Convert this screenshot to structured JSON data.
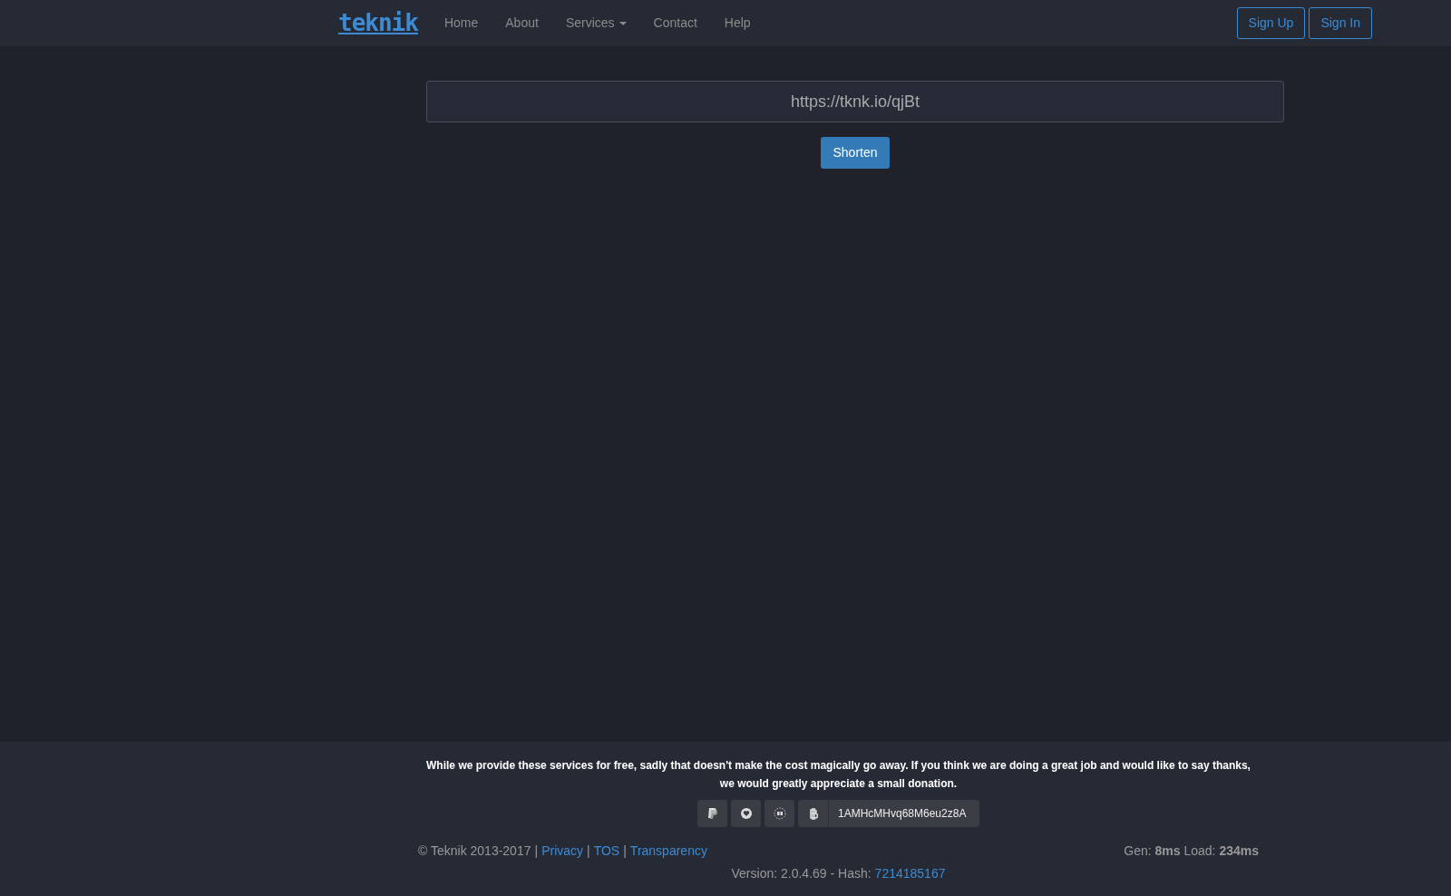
{
  "navbar": {
    "logo": "teknik",
    "items": [
      {
        "label": "Home",
        "kind": "link"
      },
      {
        "label": "About",
        "kind": "link"
      },
      {
        "label": "Services",
        "kind": "dropdown"
      },
      {
        "label": "Contact",
        "kind": "link"
      },
      {
        "label": "Help",
        "kind": "link"
      }
    ],
    "buttons": [
      "Sign Up",
      "Sign In"
    ]
  },
  "shortener": {
    "value": "https://tknk.io/qjBt",
    "button": "Shorten"
  },
  "footer": {
    "donation_text": "While we provide these services for free, sadly that doesn't make the cost magically go away. If you think we are doing a great job and would like to say thanks, we would greatly appreciate a small donation.",
    "donate_buttons": [
      {
        "kind": "paypal"
      },
      {
        "kind": "heart"
      },
      {
        "kind": "dots"
      }
    ],
    "bitcoin_address": "1AMHcMHvq68M6eu2z8A",
    "copyright": "© Teknik 2013-2017",
    "links": [
      "Privacy",
      "TOS",
      "Transparency"
    ],
    "separator": "|",
    "timing": "Gen: **8ms** Load: **234ms**",
    "version": "Version: 2.0.4.69 - Hash:",
    "hash": "7214185167"
  }
}
